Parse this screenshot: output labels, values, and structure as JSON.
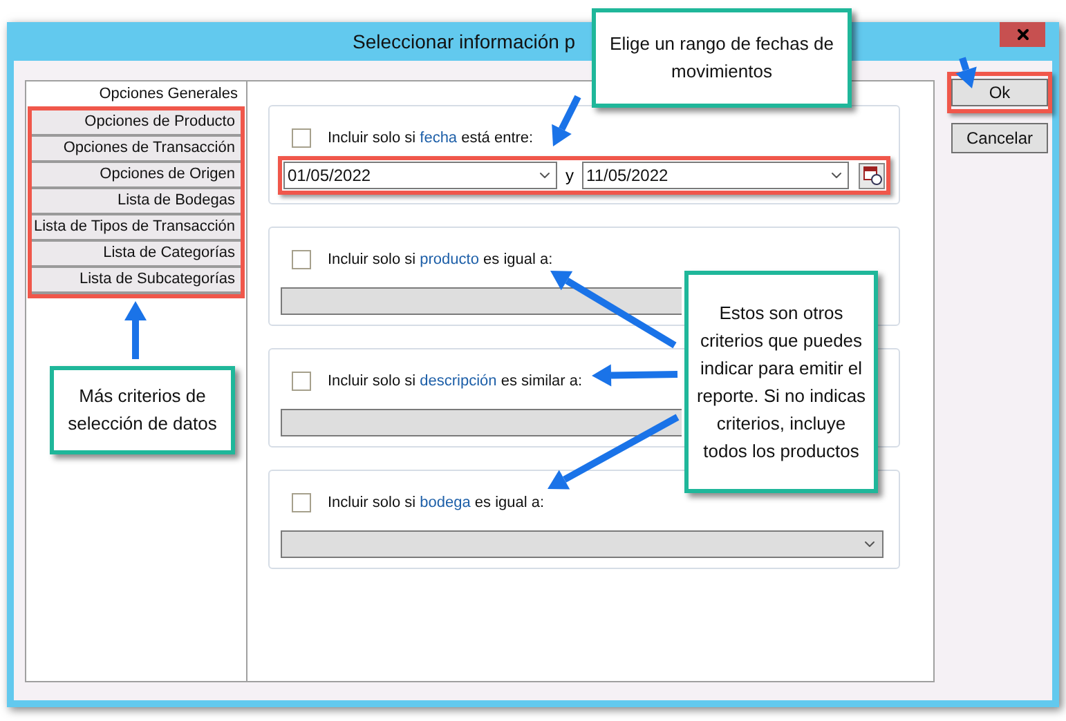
{
  "window": {
    "title": "Seleccionar información p"
  },
  "tab_panel": {
    "highlighted": true,
    "tabs": [
      {
        "label": "Opciones Generales",
        "selected": true
      },
      {
        "label": "Opciones de Producto",
        "selected": false
      },
      {
        "label": "Opciones de Transacción",
        "selected": false
      },
      {
        "label": "Opciones de Origen",
        "selected": false
      },
      {
        "label": "Lista de Bodegas",
        "selected": false
      },
      {
        "label": "Lista de Tipos de Transacción",
        "selected": false
      },
      {
        "label": "Lista de Categorías",
        "selected": false
      },
      {
        "label": "Lista de Subcategorías",
        "selected": false
      }
    ]
  },
  "filters": [
    {
      "kind": "date_range",
      "checked": false,
      "highlighted": true,
      "prefix": "Incluir solo si",
      "keyword": "fecha",
      "suffix": "está entre:",
      "from": "01/05/2022",
      "separator": "y",
      "to": "11/05/2022"
    },
    {
      "kind": "text_field",
      "checked": false,
      "disabled": true,
      "prefix": "Incluir solo si",
      "keyword": "producto",
      "suffix": "es igual a:"
    },
    {
      "kind": "text_field",
      "checked": false,
      "disabled": true,
      "prefix": "Incluir solo si",
      "keyword": "descripción",
      "suffix": "es similar a:"
    },
    {
      "kind": "dropdown",
      "checked": false,
      "disabled": true,
      "prefix": "Incluir solo si",
      "keyword": "bodega",
      "suffix": "es igual a:"
    }
  ],
  "buttons": [
    {
      "label": "Ok",
      "highlighted": true
    },
    {
      "label": "Cancelar"
    }
  ],
  "callouts": [
    {
      "text": "Elige un rango de fechas de movimientos"
    },
    {
      "text": "Más criterios de selección de datos"
    },
    {
      "text": "Estos son otros criterios que puedes indicar para emitir el reporte. Si no indicas criterios, incluye todos los productos"
    }
  ]
}
